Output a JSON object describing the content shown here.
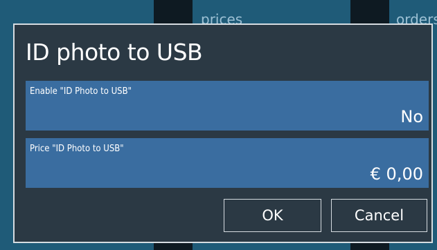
{
  "background": {
    "labels": [
      "prices",
      "orders"
    ]
  },
  "dialog": {
    "title": "ID photo to USB",
    "settings": [
      {
        "label": "Enable \"ID Photo to USB\"",
        "value": "No"
      },
      {
        "label": "Price \"ID Photo to USB\"",
        "value": "€ 0,00"
      }
    ],
    "ok_label": "OK",
    "cancel_label": "Cancel"
  },
  "colors": {
    "dialog_bg": "#2b3944",
    "row_bg": "#3a6da0",
    "border": "#d7dde2",
    "app_tile": "#1f5b78"
  }
}
